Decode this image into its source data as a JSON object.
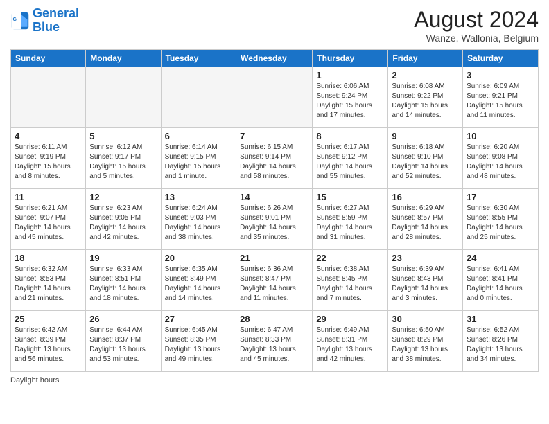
{
  "header": {
    "logo_line1": "General",
    "logo_line2": "Blue",
    "month_year": "August 2024",
    "location": "Wanze, Wallonia, Belgium"
  },
  "days_of_week": [
    "Sunday",
    "Monday",
    "Tuesday",
    "Wednesday",
    "Thursday",
    "Friday",
    "Saturday"
  ],
  "footer_label": "Daylight hours",
  "weeks": [
    [
      {
        "day": "",
        "info": ""
      },
      {
        "day": "",
        "info": ""
      },
      {
        "day": "",
        "info": ""
      },
      {
        "day": "",
        "info": ""
      },
      {
        "day": "1",
        "info": "Sunrise: 6:06 AM\nSunset: 9:24 PM\nDaylight: 15 hours\nand 17 minutes."
      },
      {
        "day": "2",
        "info": "Sunrise: 6:08 AM\nSunset: 9:22 PM\nDaylight: 15 hours\nand 14 minutes."
      },
      {
        "day": "3",
        "info": "Sunrise: 6:09 AM\nSunset: 9:21 PM\nDaylight: 15 hours\nand 11 minutes."
      }
    ],
    [
      {
        "day": "4",
        "info": "Sunrise: 6:11 AM\nSunset: 9:19 PM\nDaylight: 15 hours\nand 8 minutes."
      },
      {
        "day": "5",
        "info": "Sunrise: 6:12 AM\nSunset: 9:17 PM\nDaylight: 15 hours\nand 5 minutes."
      },
      {
        "day": "6",
        "info": "Sunrise: 6:14 AM\nSunset: 9:15 PM\nDaylight: 15 hours\nand 1 minute."
      },
      {
        "day": "7",
        "info": "Sunrise: 6:15 AM\nSunset: 9:14 PM\nDaylight: 14 hours\nand 58 minutes."
      },
      {
        "day": "8",
        "info": "Sunrise: 6:17 AM\nSunset: 9:12 PM\nDaylight: 14 hours\nand 55 minutes."
      },
      {
        "day": "9",
        "info": "Sunrise: 6:18 AM\nSunset: 9:10 PM\nDaylight: 14 hours\nand 52 minutes."
      },
      {
        "day": "10",
        "info": "Sunrise: 6:20 AM\nSunset: 9:08 PM\nDaylight: 14 hours\nand 48 minutes."
      }
    ],
    [
      {
        "day": "11",
        "info": "Sunrise: 6:21 AM\nSunset: 9:07 PM\nDaylight: 14 hours\nand 45 minutes."
      },
      {
        "day": "12",
        "info": "Sunrise: 6:23 AM\nSunset: 9:05 PM\nDaylight: 14 hours\nand 42 minutes."
      },
      {
        "day": "13",
        "info": "Sunrise: 6:24 AM\nSunset: 9:03 PM\nDaylight: 14 hours\nand 38 minutes."
      },
      {
        "day": "14",
        "info": "Sunrise: 6:26 AM\nSunset: 9:01 PM\nDaylight: 14 hours\nand 35 minutes."
      },
      {
        "day": "15",
        "info": "Sunrise: 6:27 AM\nSunset: 8:59 PM\nDaylight: 14 hours\nand 31 minutes."
      },
      {
        "day": "16",
        "info": "Sunrise: 6:29 AM\nSunset: 8:57 PM\nDaylight: 14 hours\nand 28 minutes."
      },
      {
        "day": "17",
        "info": "Sunrise: 6:30 AM\nSunset: 8:55 PM\nDaylight: 14 hours\nand 25 minutes."
      }
    ],
    [
      {
        "day": "18",
        "info": "Sunrise: 6:32 AM\nSunset: 8:53 PM\nDaylight: 14 hours\nand 21 minutes."
      },
      {
        "day": "19",
        "info": "Sunrise: 6:33 AM\nSunset: 8:51 PM\nDaylight: 14 hours\nand 18 minutes."
      },
      {
        "day": "20",
        "info": "Sunrise: 6:35 AM\nSunset: 8:49 PM\nDaylight: 14 hours\nand 14 minutes."
      },
      {
        "day": "21",
        "info": "Sunrise: 6:36 AM\nSunset: 8:47 PM\nDaylight: 14 hours\nand 11 minutes."
      },
      {
        "day": "22",
        "info": "Sunrise: 6:38 AM\nSunset: 8:45 PM\nDaylight: 14 hours\nand 7 minutes."
      },
      {
        "day": "23",
        "info": "Sunrise: 6:39 AM\nSunset: 8:43 PM\nDaylight: 14 hours\nand 3 minutes."
      },
      {
        "day": "24",
        "info": "Sunrise: 6:41 AM\nSunset: 8:41 PM\nDaylight: 14 hours\nand 0 minutes."
      }
    ],
    [
      {
        "day": "25",
        "info": "Sunrise: 6:42 AM\nSunset: 8:39 PM\nDaylight: 13 hours\nand 56 minutes."
      },
      {
        "day": "26",
        "info": "Sunrise: 6:44 AM\nSunset: 8:37 PM\nDaylight: 13 hours\nand 53 minutes."
      },
      {
        "day": "27",
        "info": "Sunrise: 6:45 AM\nSunset: 8:35 PM\nDaylight: 13 hours\nand 49 minutes."
      },
      {
        "day": "28",
        "info": "Sunrise: 6:47 AM\nSunset: 8:33 PM\nDaylight: 13 hours\nand 45 minutes."
      },
      {
        "day": "29",
        "info": "Sunrise: 6:49 AM\nSunset: 8:31 PM\nDaylight: 13 hours\nand 42 minutes."
      },
      {
        "day": "30",
        "info": "Sunrise: 6:50 AM\nSunset: 8:29 PM\nDaylight: 13 hours\nand 38 minutes."
      },
      {
        "day": "31",
        "info": "Sunrise: 6:52 AM\nSunset: 8:26 PM\nDaylight: 13 hours\nand 34 minutes."
      }
    ]
  ]
}
